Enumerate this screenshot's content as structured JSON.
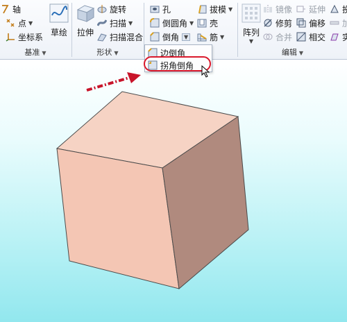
{
  "ribbon": {
    "datum": {
      "label": "基准",
      "axis": "轴",
      "point": "点",
      "csys": "坐标系",
      "sketch": "草绘"
    },
    "shapes": {
      "label": "形状",
      "extrude": "拉伸",
      "revolve": "旋转",
      "sweep": "扫描",
      "swept_blend": "扫描混合"
    },
    "engineering": {
      "hole": "孔",
      "round": "倒圆角",
      "chamfer": "倒角",
      "draft": "拔模",
      "shell": "壳",
      "rib": "筋"
    },
    "editing": {
      "label": "编辑",
      "pattern": "阵列",
      "mirror": "镜像",
      "trim": "修剪",
      "merge": "合并",
      "extend": "延伸",
      "offset": "偏移",
      "intersect": "相交",
      "project_partial": "投",
      "thicken_partial": "加",
      "solidify_partial": "实"
    }
  },
  "chamfer_menu": {
    "edge_chamfer": "边倒角",
    "corner_chamfer": "拐角倒角"
  },
  "colors": {
    "highlight_ring": "#d9182b",
    "cube_front": "#f4c6b4",
    "cube_top": "#f6d3c4",
    "cube_right": "#b08a7e",
    "arrow": "#c8142a"
  },
  "icons": {
    "axis": "axis-icon",
    "point": "point-icon",
    "csys": "coordinate-system-icon",
    "sketch": "sketch-icon",
    "extrude": "extrude-icon",
    "revolve": "revolve-icon",
    "sweep": "sweep-icon",
    "swept_blend": "swept-blend-icon",
    "hole": "hole-icon",
    "round": "round-icon",
    "chamfer": "chamfer-icon",
    "draft": "draft-icon",
    "shell": "shell-icon",
    "rib": "rib-icon",
    "pattern": "pattern-icon",
    "cursor": "cursor-icon"
  }
}
